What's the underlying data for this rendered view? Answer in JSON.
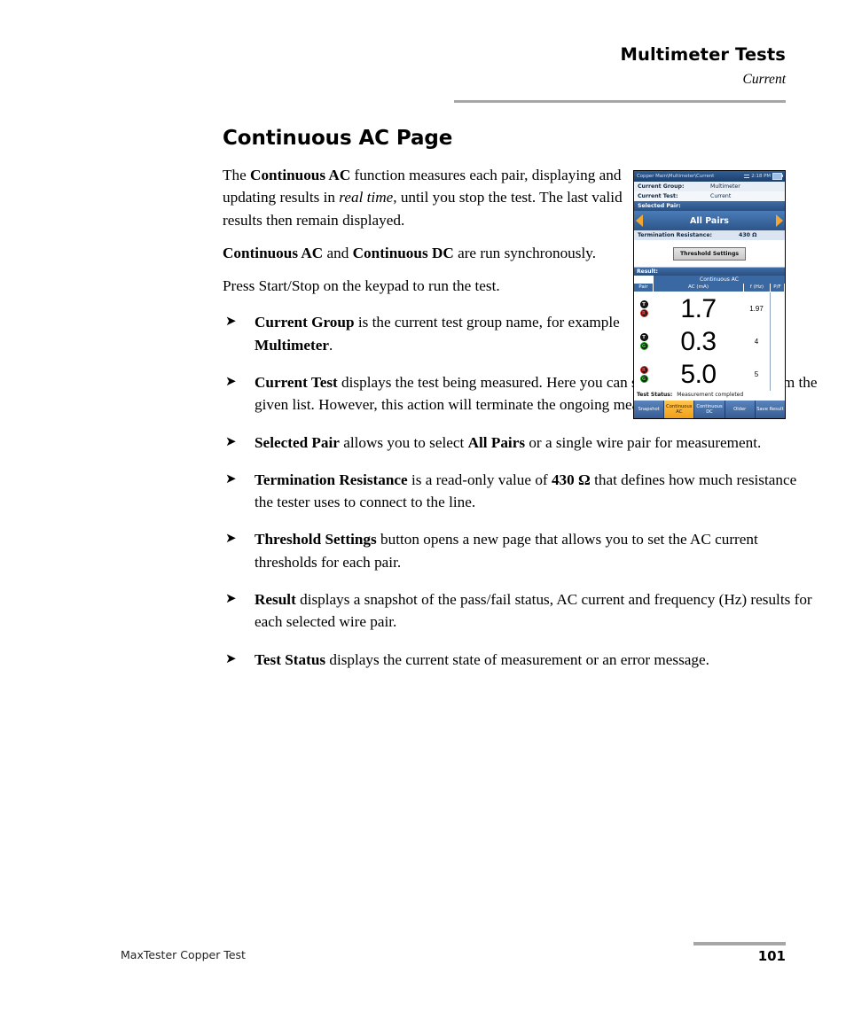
{
  "header": {
    "title": "Multimeter Tests",
    "subtitle": "Current"
  },
  "doc": {
    "title": "Continuous AC Page",
    "paragraphs": [
      {
        "id": "p1",
        "runs": [
          {
            "t": "The ",
            "s": "n"
          },
          {
            "t": "Continuous AC",
            "s": "b"
          },
          {
            "t": " function measures each pair, displaying and updating results in ",
            "s": "n"
          },
          {
            "t": "real time",
            "s": "i"
          },
          {
            "t": ", until you stop the test. The last valid results then remain displayed.",
            "s": "n"
          }
        ]
      },
      {
        "id": "p2",
        "runs": [
          {
            "t": "Continuous AC",
            "s": "b"
          },
          {
            "t": " and ",
            "s": "n"
          },
          {
            "t": "Continuous DC",
            "s": "b"
          },
          {
            "t": " are run synchronously.",
            "s": "n"
          }
        ]
      },
      {
        "id": "p3",
        "runs": [
          {
            "t": "Press Start/Stop on the keypad to run the test.",
            "s": "n"
          }
        ]
      }
    ],
    "bullet_glyph": "➤",
    "bullets": [
      {
        "width": "short",
        "runs": [
          {
            "t": "Current Group",
            "s": "b"
          },
          {
            "t": " is the current test group name, for example ",
            "s": "n"
          },
          {
            "t": "Multimeter",
            "s": "b"
          },
          {
            "t": ".",
            "s": "n"
          }
        ]
      },
      {
        "width": "wide",
        "runs": [
          {
            "t": "Current Test",
            "s": "b"
          },
          {
            "t": " displays the test being measured. Here you can switch to another test from the given list. However, this action will terminate the ongoing measurement test.",
            "s": "n"
          }
        ]
      },
      {
        "width": "wide",
        "runs": [
          {
            "t": "Selected Pair",
            "s": "b"
          },
          {
            "t": " allows you to select ",
            "s": "n"
          },
          {
            "t": "All Pairs",
            "s": "b"
          },
          {
            "t": " or a single wire pair for measurement.",
            "s": "n"
          }
        ]
      },
      {
        "width": "wide",
        "runs": [
          {
            "t": "Termination Resistance",
            "s": "b"
          },
          {
            "t": " is a read-only value of ",
            "s": "n"
          },
          {
            "t": "430 Ω",
            "s": "b"
          },
          {
            "t": " that defines how much resistance the tester uses to connect to the line.",
            "s": "n"
          }
        ]
      },
      {
        "width": "wide",
        "runs": [
          {
            "t": "Threshold Settings",
            "s": "b"
          },
          {
            "t": " button opens a new page that allows you to set the AC current thresholds for each pair.",
            "s": "n"
          }
        ]
      },
      {
        "width": "wide",
        "runs": [
          {
            "t": "Result",
            "s": "b"
          },
          {
            "t": " displays a snapshot of the pass/fail status, AC current and frequency (Hz) results for each selected wire pair.",
            "s": "n"
          }
        ]
      },
      {
        "width": "wide",
        "runs": [
          {
            "t": "Test Status",
            "s": "b"
          },
          {
            "t": " displays the current state of measurement or an error message.",
            "s": "n"
          }
        ]
      }
    ]
  },
  "footer": {
    "product": "MaxTester Copper Test",
    "page_number": "101"
  },
  "device": {
    "titlebar": {
      "breadcrumb": "Copper Main\\Multimeter\\Current",
      "time": "2:18 PM",
      "network_icon": "network-icon",
      "battery_icon": "battery-icon"
    },
    "fields": {
      "current_group_label": "Current Group:",
      "current_group_value": "Multimeter",
      "current_test_label": "Current Test:",
      "current_test_value": "Current",
      "selected_pair_label": "Selected Pair:",
      "selected_pair_value": "All Pairs",
      "prev_icon": "chevron-left-icon",
      "next_icon": "chevron-right-icon",
      "termination_label": "Termination Resistance:",
      "termination_value": "430 Ω",
      "threshold_button": "Threshold Settings"
    },
    "result": {
      "section_label": "Result:",
      "test_name": "Continuous AC",
      "columns": [
        "Pair",
        "AC (mA)",
        "f (Hz)",
        "P/F"
      ],
      "rows": [
        {
          "pair": [
            "T",
            "R"
          ],
          "pair_colors": [
            "black",
            "red"
          ],
          "ac": "1.7",
          "f": "1.97",
          "pf": ""
        },
        {
          "pair": [
            "T",
            "G"
          ],
          "pair_colors": [
            "black",
            "green"
          ],
          "ac": "0.3",
          "f": "4",
          "pf": ""
        },
        {
          "pair": [
            "R",
            "G"
          ],
          "pair_colors": [
            "red",
            "green"
          ],
          "ac": "5.0",
          "f": "5",
          "pf": ""
        }
      ],
      "status_label": "Test Status:",
      "status_value": "Measurement completed"
    },
    "buttons": [
      {
        "label": "Snapshot",
        "active": false
      },
      {
        "label": "Continuous AC",
        "active": true
      },
      {
        "label": "Continuous DC",
        "active": false
      },
      {
        "label": "Older",
        "active": false
      },
      {
        "label": "Save Result",
        "active": false
      }
    ],
    "colors": {
      "title_blue": "#2f5d96",
      "band_blue": "#3a68a2",
      "accent_orange": "#ef9b13",
      "row_light": "#e8eef6"
    }
  }
}
